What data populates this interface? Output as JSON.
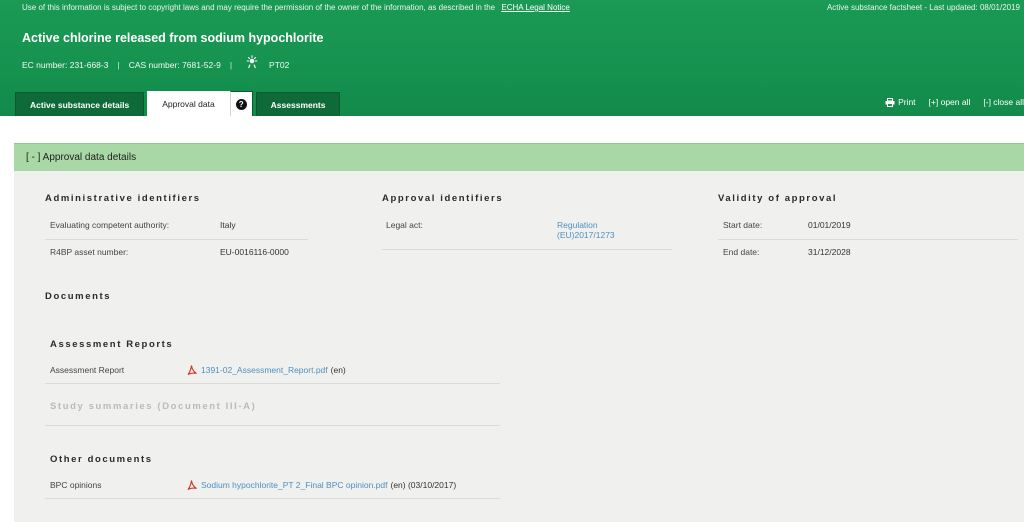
{
  "header": {
    "notice_text": "Use of this information is subject to copyright laws and may require the permission of the owner of the information, as described in the",
    "notice_link": "ECHA Legal Notice",
    "factsheet_text": "Active substance factsheet - Last updated: 08/01/2019",
    "title": "Active chlorine released from sodium hypochlorite",
    "ec_number": "EC number: 231-668-3",
    "cas_number": "CAS number: 7681-52-9",
    "separator": "|",
    "product_type": "PT02"
  },
  "tabs": [
    {
      "label": "Active substance details"
    },
    {
      "label": "Approval data"
    },
    {
      "label": "Assessments"
    }
  ],
  "help_symbol": "?",
  "actions": {
    "print": "Print",
    "open_all": "[+] open all",
    "close_all": "[-] close all"
  },
  "panel": {
    "header": "[ - ] Approval data details",
    "administrative": {
      "title": "Administrative identifiers",
      "rows": [
        {
          "label": "Evaluating competent authority:",
          "value": "Italy"
        },
        {
          "label": "R4BP asset number:",
          "value": "EU-0016116-0000"
        }
      ]
    },
    "approval": {
      "title": "Approval identifiers",
      "legal_act_label": "Legal act:",
      "legal_act_line1": "Regulation",
      "legal_act_line2": "(EU)2017/1273"
    },
    "validity": {
      "title": "Validity of approval",
      "rows": [
        {
          "label": "Start date:",
          "value": "01/01/2019"
        },
        {
          "label": "End date:",
          "value": "31/12/2028"
        }
      ]
    },
    "documents": {
      "title": "Documents",
      "assessment_reports_title": "Assessment Reports",
      "assessment_report_label": "Assessment Report",
      "assessment_report_file": "1391-02_Assessment_Report.pdf",
      "assessment_report_lang": "(en)",
      "study_summaries_title": "Study summaries (Document III-A)",
      "other_documents_title": "Other documents",
      "bpc_label": "BPC opinions",
      "bpc_file": "Sodium hypochlorite_PT 2_Final BPC opinion.pdf",
      "bpc_meta": "(en) (03/10/2017)"
    }
  },
  "colors": {
    "header_green": "#16924f",
    "tab_dark_green": "#0e6b39",
    "panel_header_green": "#a8d8a5",
    "panel_bg": "#f0f1ef",
    "link_blue": "#4f8fbf",
    "pdf_red": "#d2342b"
  },
  "icons": [
    "print-icon",
    "help-icon",
    "product-type-icon",
    "pdf-icon"
  ]
}
